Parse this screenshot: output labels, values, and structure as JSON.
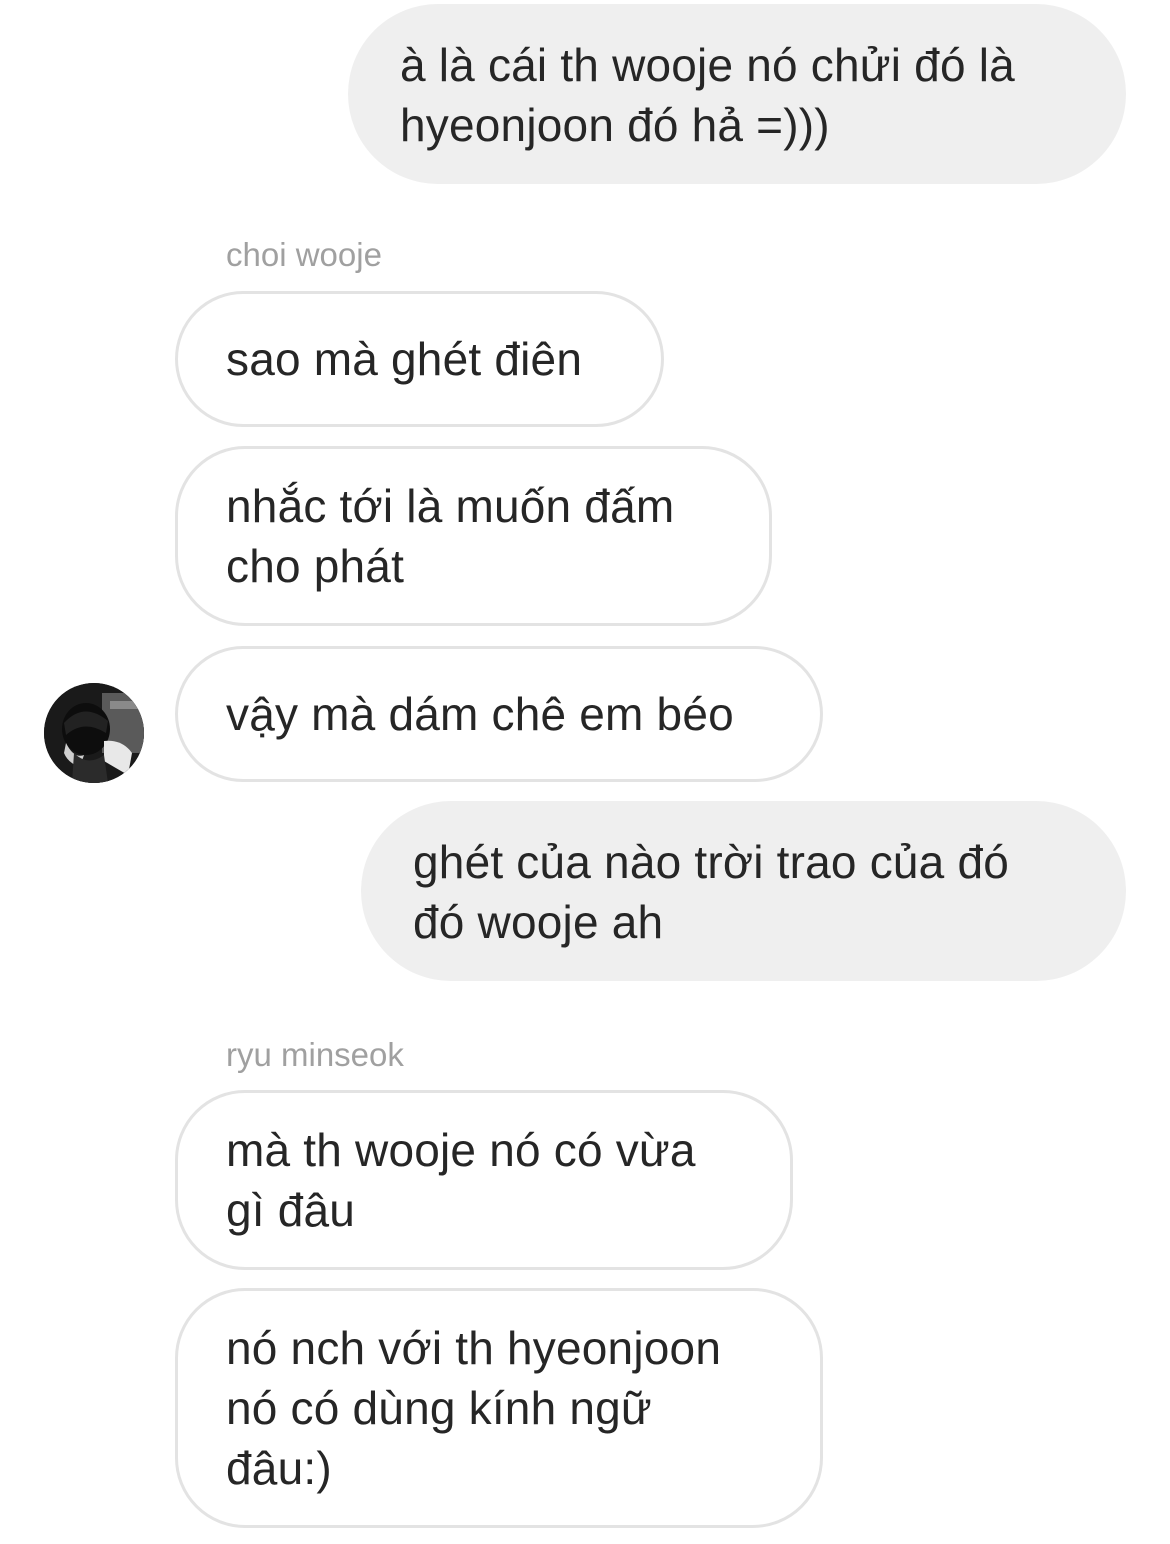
{
  "messages": [
    {
      "side": "sent",
      "lines": [
        "à là cái th wooje nó chửi đó là",
        "hyeonjoon đó hả =)))"
      ]
    },
    {
      "side": "received",
      "sender": "choi wooje",
      "lines": [
        "sao mà ghét điên"
      ]
    },
    {
      "side": "received",
      "lines": [
        "nhắc tới là muốn đấm",
        "cho phát"
      ]
    },
    {
      "side": "received",
      "lines": [
        "vậy mà dám chê em béo"
      ]
    },
    {
      "side": "sent",
      "lines": [
        "ghét của nào trời trao của đó",
        "đó wooje ah"
      ]
    },
    {
      "side": "received",
      "sender": "ryu minseok",
      "lines": [
        "mà th wooje nó có vừa",
        "gì đâu"
      ]
    },
    {
      "side": "received",
      "lines": [
        "nó nch với th hyeonjoon",
        "nó có dùng kính ngữ",
        "đâu:)"
      ]
    }
  ],
  "avatar": {
    "icon": "profile-photo"
  }
}
